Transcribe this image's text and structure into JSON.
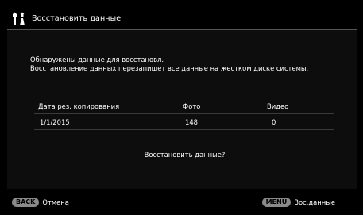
{
  "header": {
    "title": "Восстановить данные",
    "icon": "hdd-restore-icon"
  },
  "message": {
    "line1": "Обнаружены данные для восстановл.",
    "line2": "Восстановление данных перезапишет все данные на жестком диске системы."
  },
  "table": {
    "columns": [
      "Дата рез. копирования",
      "Фото",
      "Видео"
    ],
    "rows": [
      [
        "1/1/2015",
        "148",
        "0"
      ]
    ]
  },
  "prompt": "Восстановить данные?",
  "footer": {
    "back_key": "BACK",
    "back_label": "Отмена",
    "menu_key": "MENU",
    "menu_label": "Вос.данные"
  },
  "colors": {
    "background": "#000000",
    "divider": "#3a3a3a",
    "key_badge": "#8a8a8a"
  }
}
